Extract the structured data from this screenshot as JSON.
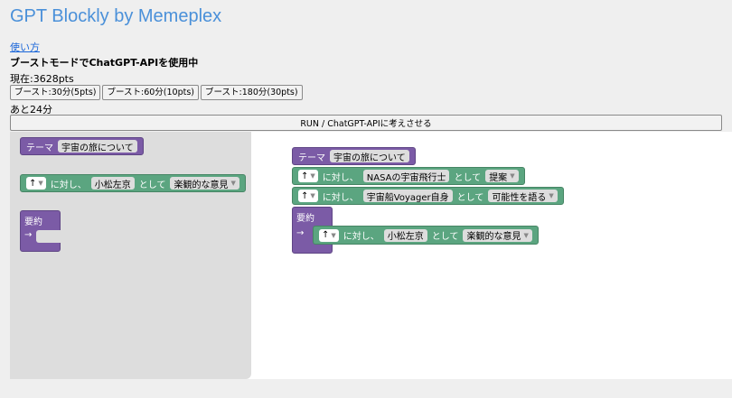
{
  "header": {
    "title": "GPT Blockly by Memeplex",
    "help_link": "使い方",
    "mode_text": "ブーストモードでChatGPT-APIを使用中",
    "points_text": "現在:3628pts",
    "boost_buttons": [
      "ブースト:30分(5pts)",
      "ブースト:60分(10pts)",
      "ブースト:180分(30pts)"
    ],
    "remaining_text": "あと24分",
    "run_button": "RUN / ChatGPT-APIに考えさせる"
  },
  "toolbox": {
    "theme_label": "テーマ",
    "theme_value": "宇宙の旅について",
    "relation": {
      "arrow": "↑",
      "for_label": "に対し、",
      "person": "小松左京",
      "as_label": "として",
      "opinion": "楽観的な意見"
    },
    "summary_label": "要約",
    "summary_arrow": "→"
  },
  "workspace": {
    "theme_label": "テーマ",
    "theme_value": "宇宙の旅について",
    "rows": [
      {
        "arrow": "↑",
        "for_label": "に対し、",
        "person": "NASAの宇宙飛行士",
        "as_label": "として",
        "opinion": "提案"
      },
      {
        "arrow": "↑",
        "for_label": "に対し、",
        "person": "宇宙船Voyager自身",
        "as_label": "として",
        "opinion": "可能性を語る"
      }
    ],
    "summary_label": "要約",
    "summary_arrow": "→",
    "summary_row": {
      "arrow": "↑",
      "for_label": "に対し、",
      "person": "小松左京",
      "as_label": "として",
      "opinion": "楽観的な意見"
    }
  },
  "colors": {
    "title": "#4a90d9",
    "purple_block": "#7b5ba6",
    "green_block": "#5ba580",
    "toolbox_bg": "#dddddd"
  }
}
